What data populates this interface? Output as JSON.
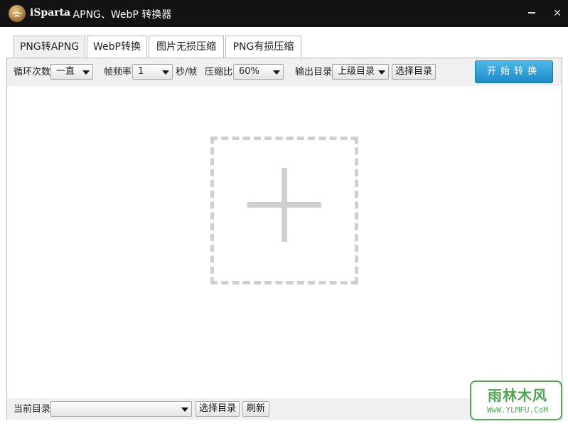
{
  "window": {
    "title_app": "iSparta",
    "title_rest": "-- APNG、WebP 转换器",
    "minimize_icon": "minimize-icon",
    "close_label": "✕"
  },
  "tabs": [
    {
      "label": "PNG转APNG",
      "active": true
    },
    {
      "label": "WebP转换",
      "active": false
    },
    {
      "label": "图片无损压缩",
      "active": false
    },
    {
      "label": "PNG有损压缩",
      "active": false
    }
  ],
  "toolbar": {
    "loop_label": "循环次数",
    "loop_value": "一直",
    "framerate_label": "帧频率",
    "framerate_value": "1",
    "framerate_unit": "秒/帧",
    "compress_label": "压缩比",
    "compress_value": "60%",
    "output_label": "输出目录",
    "output_value": "上级目录",
    "select_dir_button": "选择目录",
    "start_button": "开始转换"
  },
  "drop_zone": {
    "icon": "plus-icon"
  },
  "bottom": {
    "current_dir_label": "当前目录",
    "current_dir_value": "",
    "select_dir_button": "选择目录",
    "refresh_button": "刷新"
  },
  "watermark": {
    "text": "雨林木风",
    "url": "WwW.YLMFU.CoM"
  },
  "colors": {
    "titlebar": "#131313",
    "start_button": "#2aa0dc",
    "toolbar_bg": "#f0f0f0",
    "drop_zone_dash": "#cfcfcf"
  }
}
